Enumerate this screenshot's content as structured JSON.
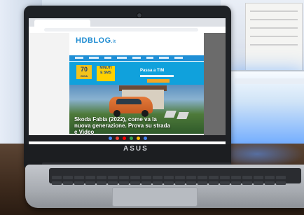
{
  "site": {
    "logo": "HDBLOG",
    "logo_suffix": ".it",
    "promo_badge_value": "70",
    "promo_badge_small": "GIGA",
    "promo_box_line1": "MINUTI",
    "promo_box_line2": "E SMS",
    "promo_text": "Passa a TIM",
    "hero_title": "Skoda Fabia (2022), come va la nuova generazione. Prova su strada e Video"
  },
  "laptop": {
    "brand": "ASUS"
  },
  "colors": {
    "site_accent": "#1f8fd6",
    "promo_blue": "#10a1dc",
    "promo_yellow": "#f2c21b",
    "car_orange": "#e57a3a"
  },
  "icons": {
    "webcam": "camera-icon",
    "shelf": [
      "chrome-icon",
      "gmail-icon",
      "youtube-icon",
      "play-store-icon",
      "files-icon",
      "docs-icon"
    ]
  }
}
